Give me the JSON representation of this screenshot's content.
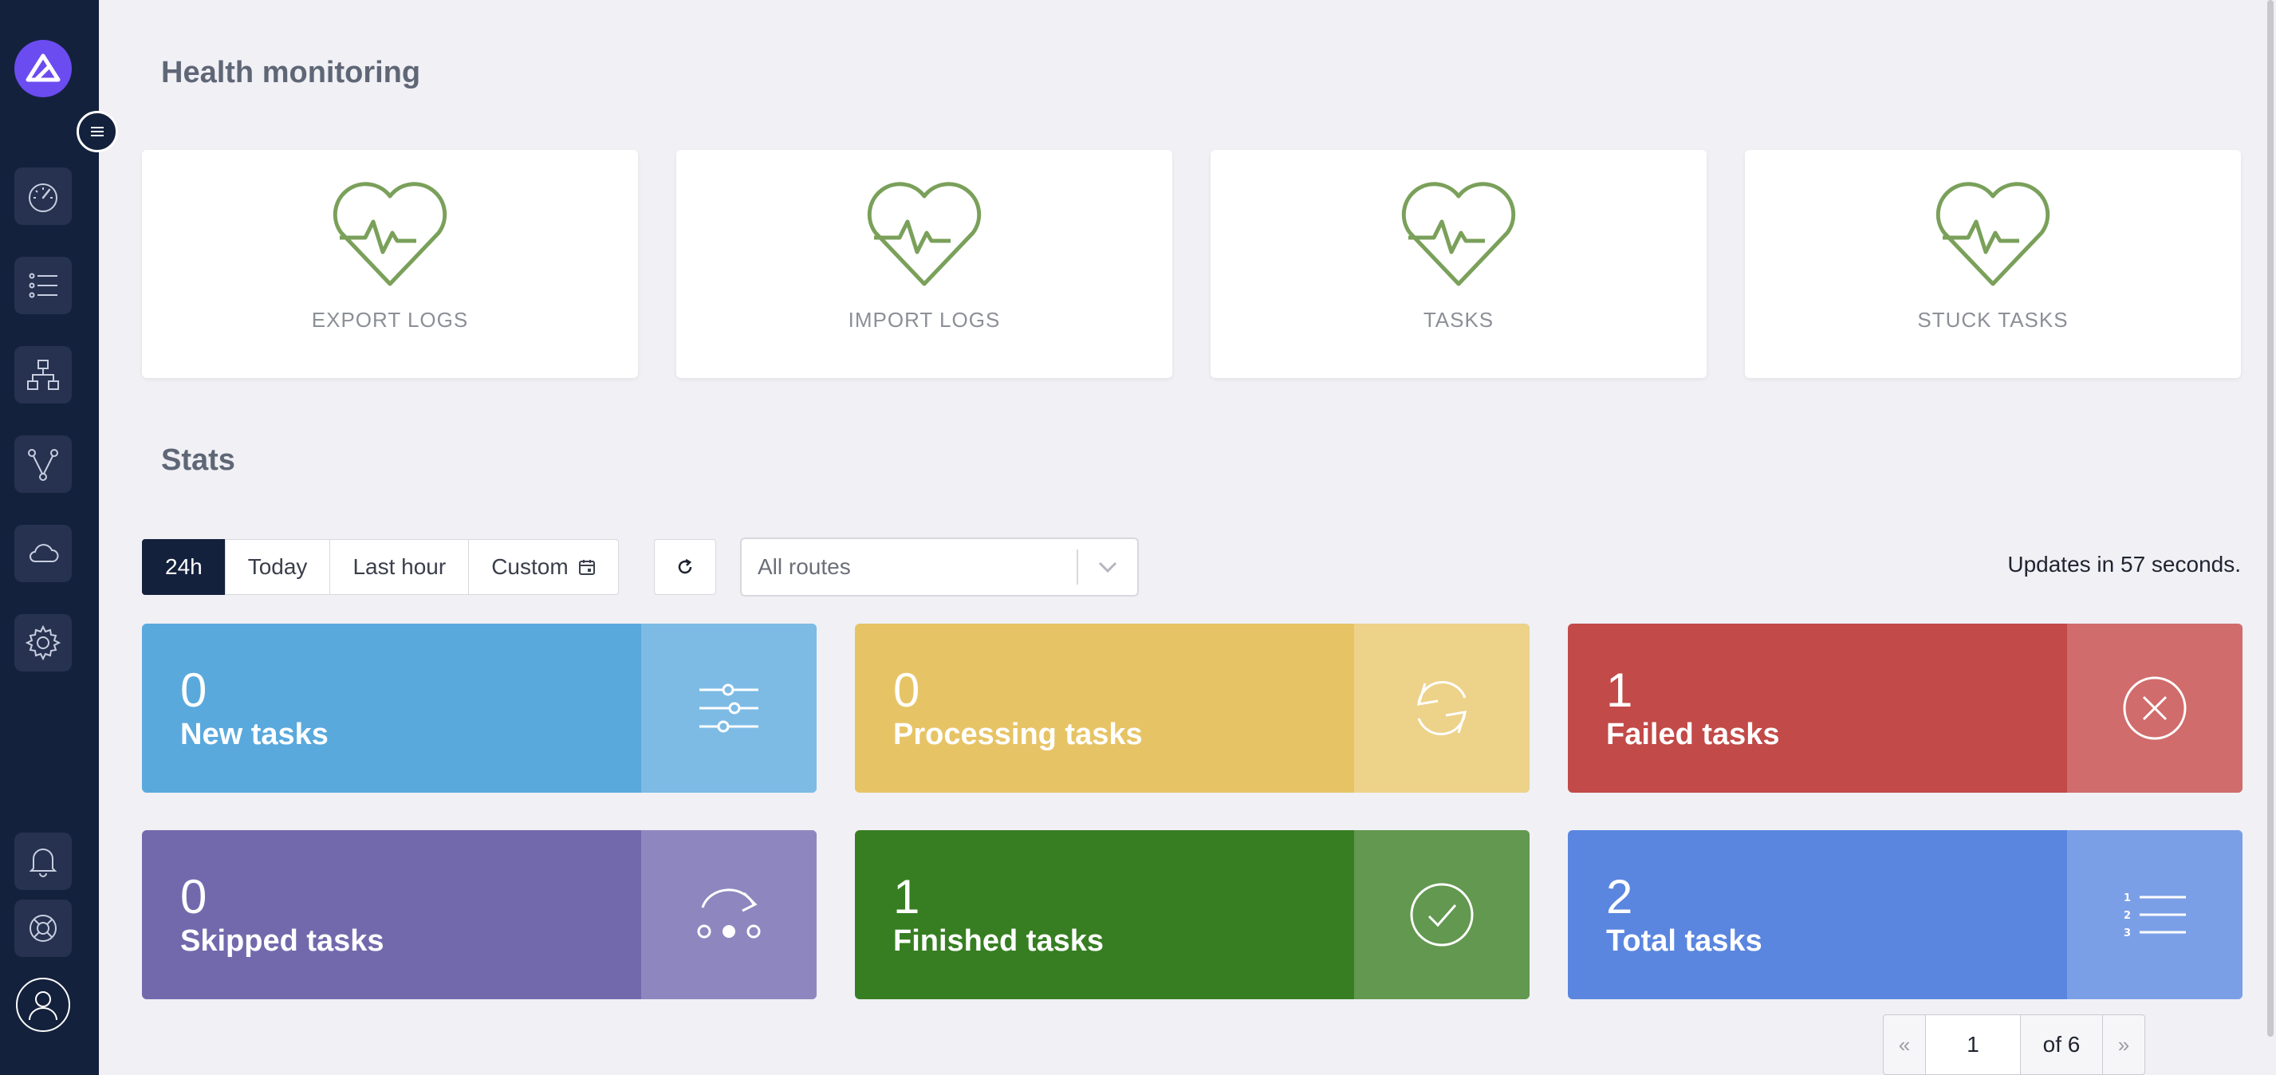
{
  "health": {
    "title": "Health monitoring",
    "cards": [
      {
        "label": "EXPORT LOGS"
      },
      {
        "label": "IMPORT LOGS"
      },
      {
        "label": "TASKS"
      },
      {
        "label": "STUCK TASKS"
      }
    ],
    "icon_color": "#7aa05a"
  },
  "stats": {
    "title": "Stats",
    "ranges": [
      "24h",
      "Today",
      "Last hour",
      "Custom"
    ],
    "active_range": "24h",
    "route_select": "All routes",
    "updates_text": "Updates in 57 seconds.",
    "cards": [
      {
        "value": "0",
        "label": "New tasks",
        "color": "#5aa9dd",
        "accent": "#7dbbe5",
        "icon": "sliders-icon"
      },
      {
        "value": "0",
        "label": "Processing tasks",
        "color": "#e6c466",
        "accent": "#edd28a",
        "icon": "refresh-cycle-icon"
      },
      {
        "value": "1",
        "label": "Failed tasks",
        "color": "#c24a48",
        "accent": "#d06c6b",
        "icon": "circle-x-icon"
      },
      {
        "value": "0",
        "label": "Skipped tasks",
        "color": "#7269ad",
        "accent": "#8e87bf",
        "icon": "skip-dots-icon"
      },
      {
        "value": "1",
        "label": "Finished tasks",
        "color": "#377e22",
        "accent": "#62984f",
        "icon": "circle-check-icon"
      },
      {
        "value": "2",
        "label": "Total tasks",
        "color": "#5a86df",
        "accent": "#7b9fe7",
        "icon": "ordered-list-icon"
      }
    ]
  },
  "pagination": {
    "prev": "«",
    "current": "1",
    "of_text": "of 6",
    "next": "»",
    "page_size": "10"
  }
}
